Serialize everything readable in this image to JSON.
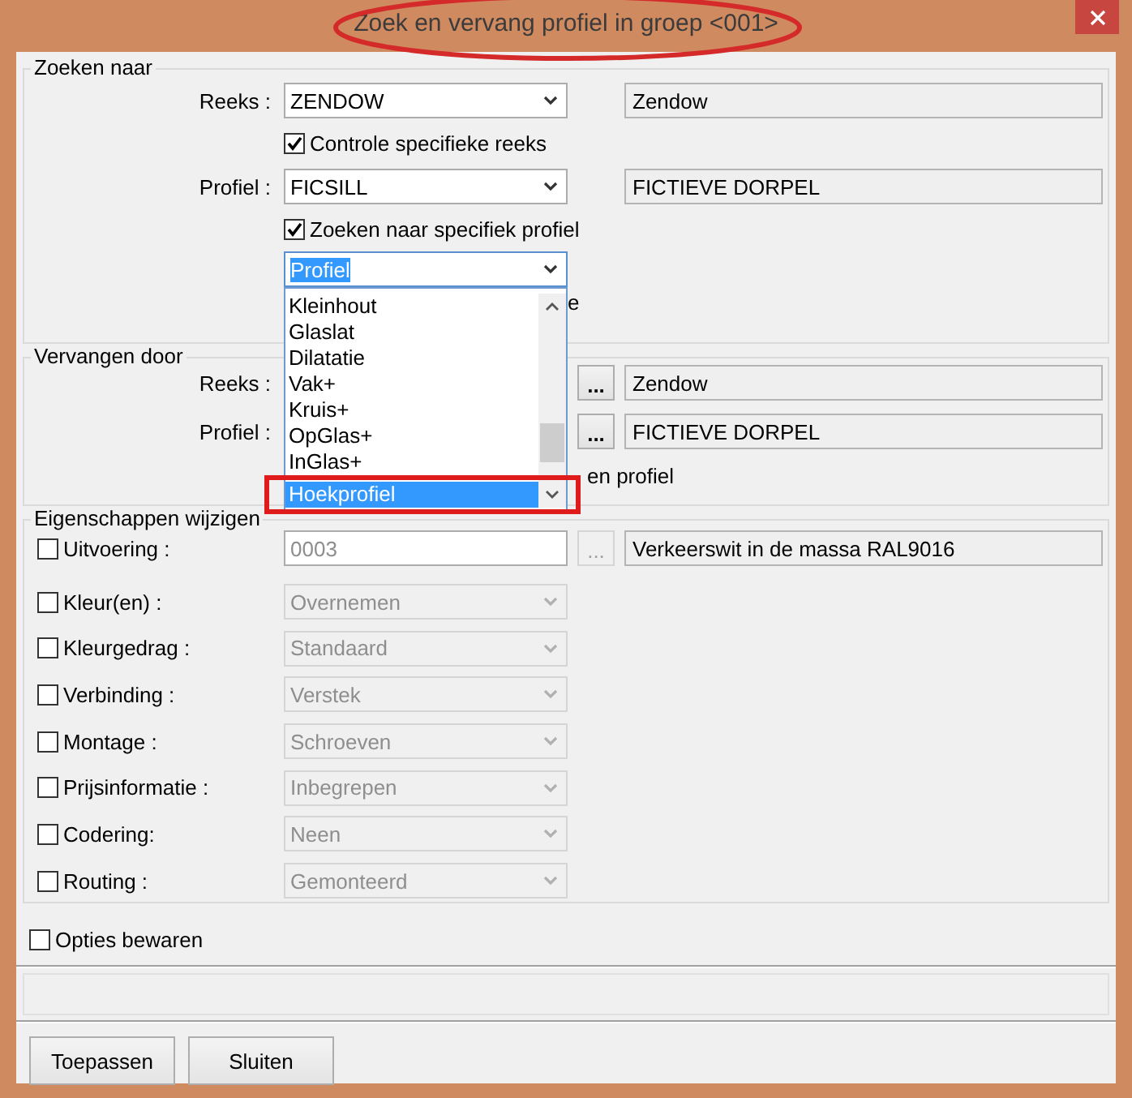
{
  "window": {
    "title": "Zoek en vervang profiel in groep <001>"
  },
  "search_group": {
    "title": "Zoeken naar",
    "reeks": {
      "label": "Reeks :",
      "value": "ZENDOW",
      "description": "Zendow"
    },
    "reeks_check": {
      "label": "Controle specifieke reeks",
      "checked": true
    },
    "profiel": {
      "label": "Profiel :",
      "value": "FICSILL",
      "description": "FICTIEVE DORPEL"
    },
    "profiel_check": {
      "label": "Zoeken naar specifiek profiel",
      "checked": true
    },
    "type_combo": {
      "value": "Profiel",
      "expanded": true,
      "options": [
        {
          "label": "Kleinhout",
          "selected": false
        },
        {
          "label": "Glaslat",
          "selected": false
        },
        {
          "label": "Dilatatie",
          "selected": false
        },
        {
          "label": "Vak+",
          "selected": false
        },
        {
          "label": "Kruis+",
          "selected": false
        },
        {
          "label": "OpGlas+",
          "selected": false
        },
        {
          "label": "InGlas+",
          "selected": false
        },
        {
          "label": "Hoekprofiel",
          "selected": true
        }
      ]
    },
    "covered_label_tail": "e"
  },
  "replace_group": {
    "title": "Vervangen door",
    "reeks": {
      "label": "Reeks :",
      "button": "...",
      "description": "Zendow"
    },
    "profiel": {
      "label": "Profiel :",
      "button": "...",
      "description": "FICTIEVE DORPEL"
    },
    "covered_label_tail": "en profiel"
  },
  "properties_group": {
    "title": "Eigenschappen wijzigen",
    "rows": [
      {
        "kind": "code",
        "label": "Uitvoering :",
        "checked": false,
        "value": "0003",
        "button": "...",
        "description": "Verkeerswit in de massa RAL9016"
      },
      {
        "kind": "combo",
        "label": "Kleur(en) :",
        "checked": false,
        "value": "Overnemen",
        "disabled": true
      },
      {
        "kind": "combo",
        "label": "Kleurgedrag :",
        "checked": false,
        "value": "Standaard",
        "disabled": true
      },
      {
        "kind": "combo",
        "label": "Verbinding :",
        "checked": false,
        "value": "Verstek",
        "disabled": true
      },
      {
        "kind": "combo",
        "label": "Montage :",
        "checked": false,
        "value": "Schroeven",
        "disabled": true
      },
      {
        "kind": "combo",
        "label": "Prijsinformatie :",
        "checked": false,
        "value": "Inbegrepen",
        "disabled": true
      },
      {
        "kind": "combo",
        "label": "Codering:",
        "checked": false,
        "value": "Neen",
        "disabled": true
      },
      {
        "kind": "combo",
        "label": "Routing :",
        "checked": false,
        "value": "Gemonteerd",
        "disabled": true
      }
    ]
  },
  "save_options": {
    "label": "Opties bewaren",
    "checked": false
  },
  "buttons": [
    "Toepassen",
    "Sluiten"
  ],
  "annotations": [
    {
      "kind": "ellipse",
      "color": "#d42a2a"
    },
    {
      "kind": "rectangle",
      "color": "#e01b1b"
    }
  ]
}
